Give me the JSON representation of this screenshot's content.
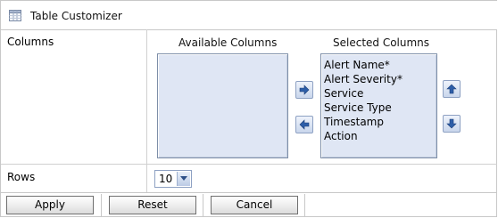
{
  "header": {
    "title": "Table Customizer",
    "icon": "table-icon"
  },
  "columns_row": {
    "label": "Columns",
    "available_heading": "Available Columns",
    "selected_heading": "Selected Columns",
    "available": [],
    "selected": [
      "Alert Name*",
      "Alert Severity*",
      "Service",
      "Service Type",
      "Timestamp",
      "Action"
    ]
  },
  "rows_row": {
    "label": "Rows",
    "value": "10"
  },
  "buttons": {
    "apply": "Apply",
    "reset": "Reset",
    "cancel": "Cancel"
  },
  "colors": {
    "list_bg": "#dfe6f4",
    "arrow_blue": "#2d5ea8",
    "border": "#c8c8c8"
  }
}
